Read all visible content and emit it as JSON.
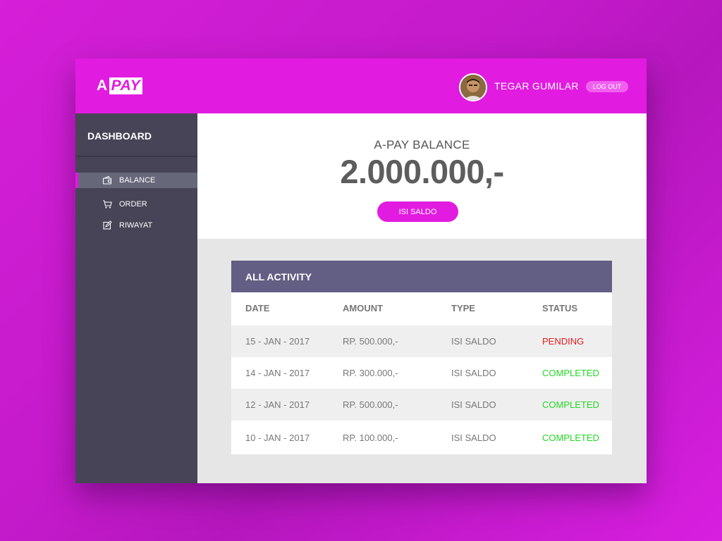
{
  "logo": {
    "part1": "A",
    "part2": "PAY"
  },
  "user": {
    "name": "TEGAR GUMILAR",
    "logout_label": "LOG OUT"
  },
  "sidebar": {
    "title": "DASHBOARD",
    "items": [
      {
        "label": "BALANCE",
        "icon": "wallet-icon",
        "active": true
      },
      {
        "label": "ORDER",
        "icon": "cart-icon",
        "active": false
      },
      {
        "label": "RIWAYAT",
        "icon": "edit-icon",
        "active": false
      }
    ]
  },
  "balance": {
    "title": "A-PAY BALANCE",
    "amount": "2.000.000,-",
    "topup_label": "ISI SALDO"
  },
  "activity": {
    "title": "ALL ACTIVITY",
    "columns": [
      "DATE",
      "AMOUNT",
      "TYPE",
      "STATUS"
    ],
    "rows": [
      {
        "date": "15 - JAN - 2017",
        "amount": "RP. 500.000,-",
        "type": "ISI SALDO",
        "status": "PENDING"
      },
      {
        "date": "14 - JAN - 2017",
        "amount": "RP. 300.000,-",
        "type": "ISI SALDO",
        "status": "COMPLETED"
      },
      {
        "date": "12 - JAN - 2017",
        "amount": "RP. 500.000,-",
        "type": "ISI SALDO",
        "status": "COMPLETED"
      },
      {
        "date": "10 - JAN - 2017",
        "amount": "RP. 100.000,-",
        "type": "ISI SALDO",
        "status": "COMPLETED"
      }
    ]
  },
  "colors": {
    "accent": "#e21be0",
    "sidebar": "#474457",
    "table_header": "#635e83",
    "pending": "#e41c1c",
    "completed": "#22d822"
  }
}
